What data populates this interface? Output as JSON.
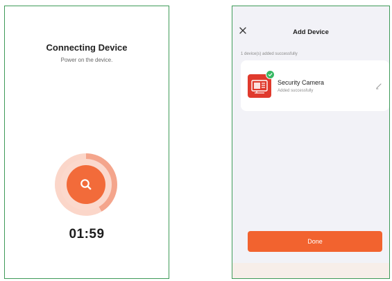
{
  "left_screen": {
    "title": "Connecting Device",
    "subtitle": "Power on the device.",
    "countdown": "01:59",
    "icon": "search-icon",
    "accent_color": "#f26b3a"
  },
  "right_screen": {
    "header": {
      "title": "Add Device",
      "close_icon": "close-icon"
    },
    "added_summary": "1 device(s) added successfully",
    "device": {
      "name": "Security Camera",
      "status": "Added successfully",
      "thumbnail_icon": "security-camera-icon",
      "badge_icon": "check-icon",
      "edit_icon": "pencil-icon"
    },
    "done_label": "Done",
    "accent_color": "#f2632f",
    "success_color": "#38b864"
  }
}
